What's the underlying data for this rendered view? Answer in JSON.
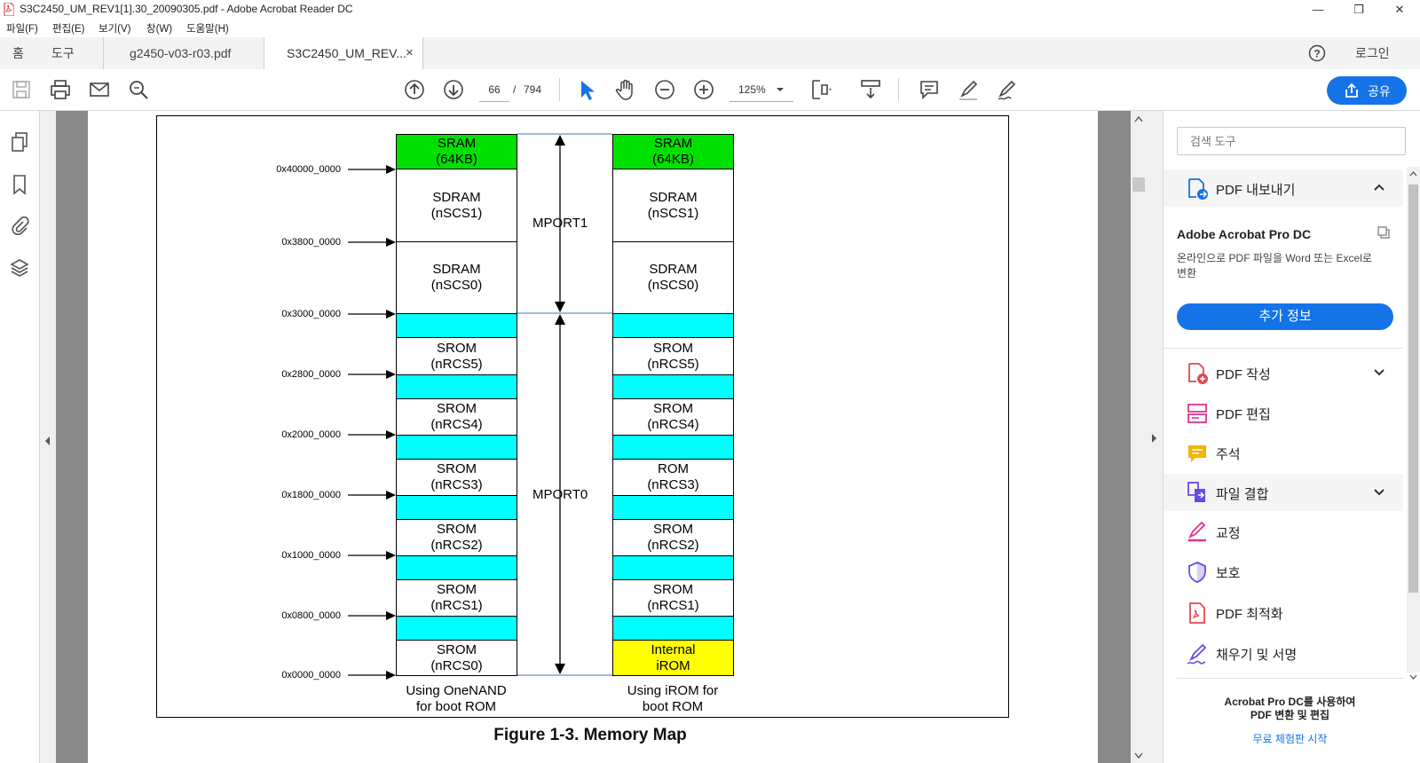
{
  "window": {
    "title": "S3C2450_UM_REV1[1].30_20090305.pdf - Adobe Acrobat Reader DC",
    "minimize": "—",
    "restore": "❐",
    "close": "✕"
  },
  "menu": [
    "파일(F)",
    "편집(E)",
    "보기(V)",
    "창(W)",
    "도움말(H)"
  ],
  "tabs": {
    "home": "홈",
    "tools": "도구",
    "doc1": "g2450-v03-r03.pdf",
    "doc2": "S3C2450_UM_REV...",
    "close": "×",
    "help": "?",
    "login": "로그인"
  },
  "toolbar": {
    "page_current": "66",
    "page_sep": "/",
    "page_total": "794",
    "zoom": "125%",
    "share_label": "공유"
  },
  "right_panel": {
    "search_placeholder": "검색 도구",
    "export_label": "PDF 내보내기",
    "product": "Adobe Acrobat Pro DC",
    "product_desc": "온라인으로 PDF 파일을 Word 또는 Excel로 변환",
    "more_info": "추가 정보",
    "tools": [
      "PDF 작성",
      "PDF 편집",
      "주석",
      "파일 결합",
      "교정",
      "보호",
      "PDF 최적화",
      "채우기 및 서명"
    ],
    "promo_line1": "Acrobat Pro DC를 사용하여",
    "promo_line2": "PDF 변환 및 편집",
    "trial": "무료 체험판 시작"
  },
  "diagram": {
    "caption": "Figure 1-3. Memory Map",
    "addresses": [
      "0x40000_0000",
      "0x3800_0000",
      "0x3000_0000",
      "0x2800_0000",
      "0x2000_0000",
      "0x1800_0000",
      "0x1000_0000",
      "0x0800_0000",
      "0x0000_0000"
    ],
    "mport1": "MPORT1",
    "mport0": "MPORT0",
    "left_col": [
      "SRAM",
      "(64KB)",
      "SDRAM",
      "(nSCS1)",
      "SDRAM",
      "(nSCS0)",
      "SROM",
      "(nRCS5)",
      "SROM",
      "(nRCS4)",
      "SROM",
      "(nRCS3)",
      "SROM",
      "(nRCS2)",
      "SROM",
      "(nRCS1)",
      "SROM",
      "(nRCS0)"
    ],
    "right_col": [
      "SRAM",
      "(64KB)",
      "SDRAM",
      "(nSCS1)",
      "SDRAM",
      "(nSCS0)",
      "SROM",
      "(nRCS5)",
      "SROM",
      "(nRCS4)",
      "ROM",
      "(nRCS3)",
      "SROM",
      "(nRCS2)",
      "SROM",
      "(nRCS1)",
      "Internal",
      "iROM"
    ],
    "left_caption": [
      "Using OneNAND",
      "for boot ROM"
    ],
    "right_caption": [
      "Using iROM for",
      "boot ROM"
    ],
    "colors": {
      "sram": "#00e000",
      "reserved": "#00ffff",
      "irom": "#ffff00"
    }
  }
}
